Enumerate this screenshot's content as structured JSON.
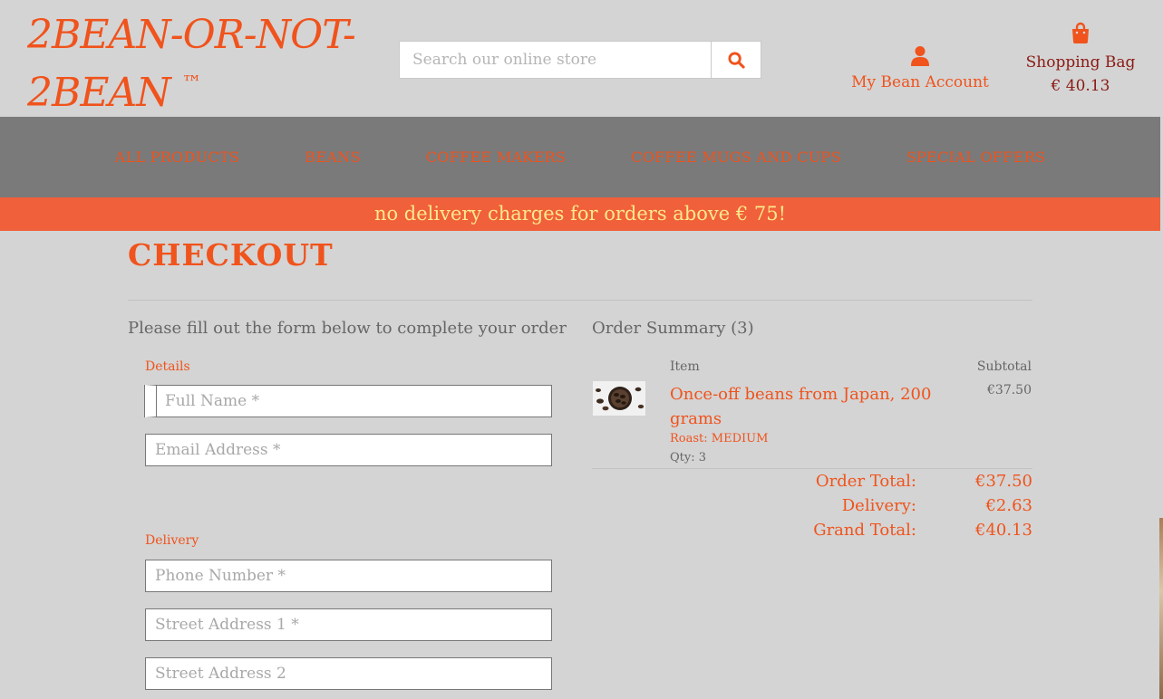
{
  "header": {
    "logo_line1": "2BEAN-OR-NOT-",
    "logo_line2": "2BEAN",
    "logo_tm": "™",
    "search_placeholder": "Search our online store",
    "account_label": "My Bean Account",
    "bag_label": "Shopping Bag",
    "bag_total": "€ 40.13"
  },
  "nav": {
    "items": [
      "ALL PRODUCTS",
      "BEANS",
      "COFFEE MAKERS",
      "COFFEE MUGS AND CUPS",
      "SPECIAL OFFERS"
    ]
  },
  "banner": {
    "text": "no delivery charges for orders above € 75!"
  },
  "checkout": {
    "title": "CHECKOUT",
    "intro": "Please fill out the form below to complete your order",
    "details_label": "Details",
    "delivery_label": "Delivery",
    "fields": {
      "full_name": "Full Name *",
      "email": "Email Address *",
      "phone": "Phone Number *",
      "street1": "Street Address 1 *",
      "street2": "Street Address 2"
    }
  },
  "summary": {
    "title": "Order Summary (3)",
    "col_item": "Item",
    "col_subtotal": "Subtotal",
    "item": {
      "name": "Once-off beans from Japan, 200 grams",
      "roast": "Roast: MEDIUM",
      "qty": "Qty: 3",
      "subtotal": "€37.50"
    },
    "order_total_label": "Order Total:",
    "order_total": "€37.50",
    "delivery_label": "Delivery:",
    "delivery": "€2.63",
    "grand_total_label": "Grand Total:",
    "grand_total": "€40.13"
  },
  "colors": {
    "accent": "#f0531c",
    "nav_bg": "#7a7a7a",
    "banner_bg": "#f0603a",
    "banner_text": "#ffe88c",
    "page_bg": "#d4d4d4"
  },
  "icons": {
    "search": "search-icon",
    "account": "user-icon",
    "bag": "shopping-bag-icon"
  }
}
